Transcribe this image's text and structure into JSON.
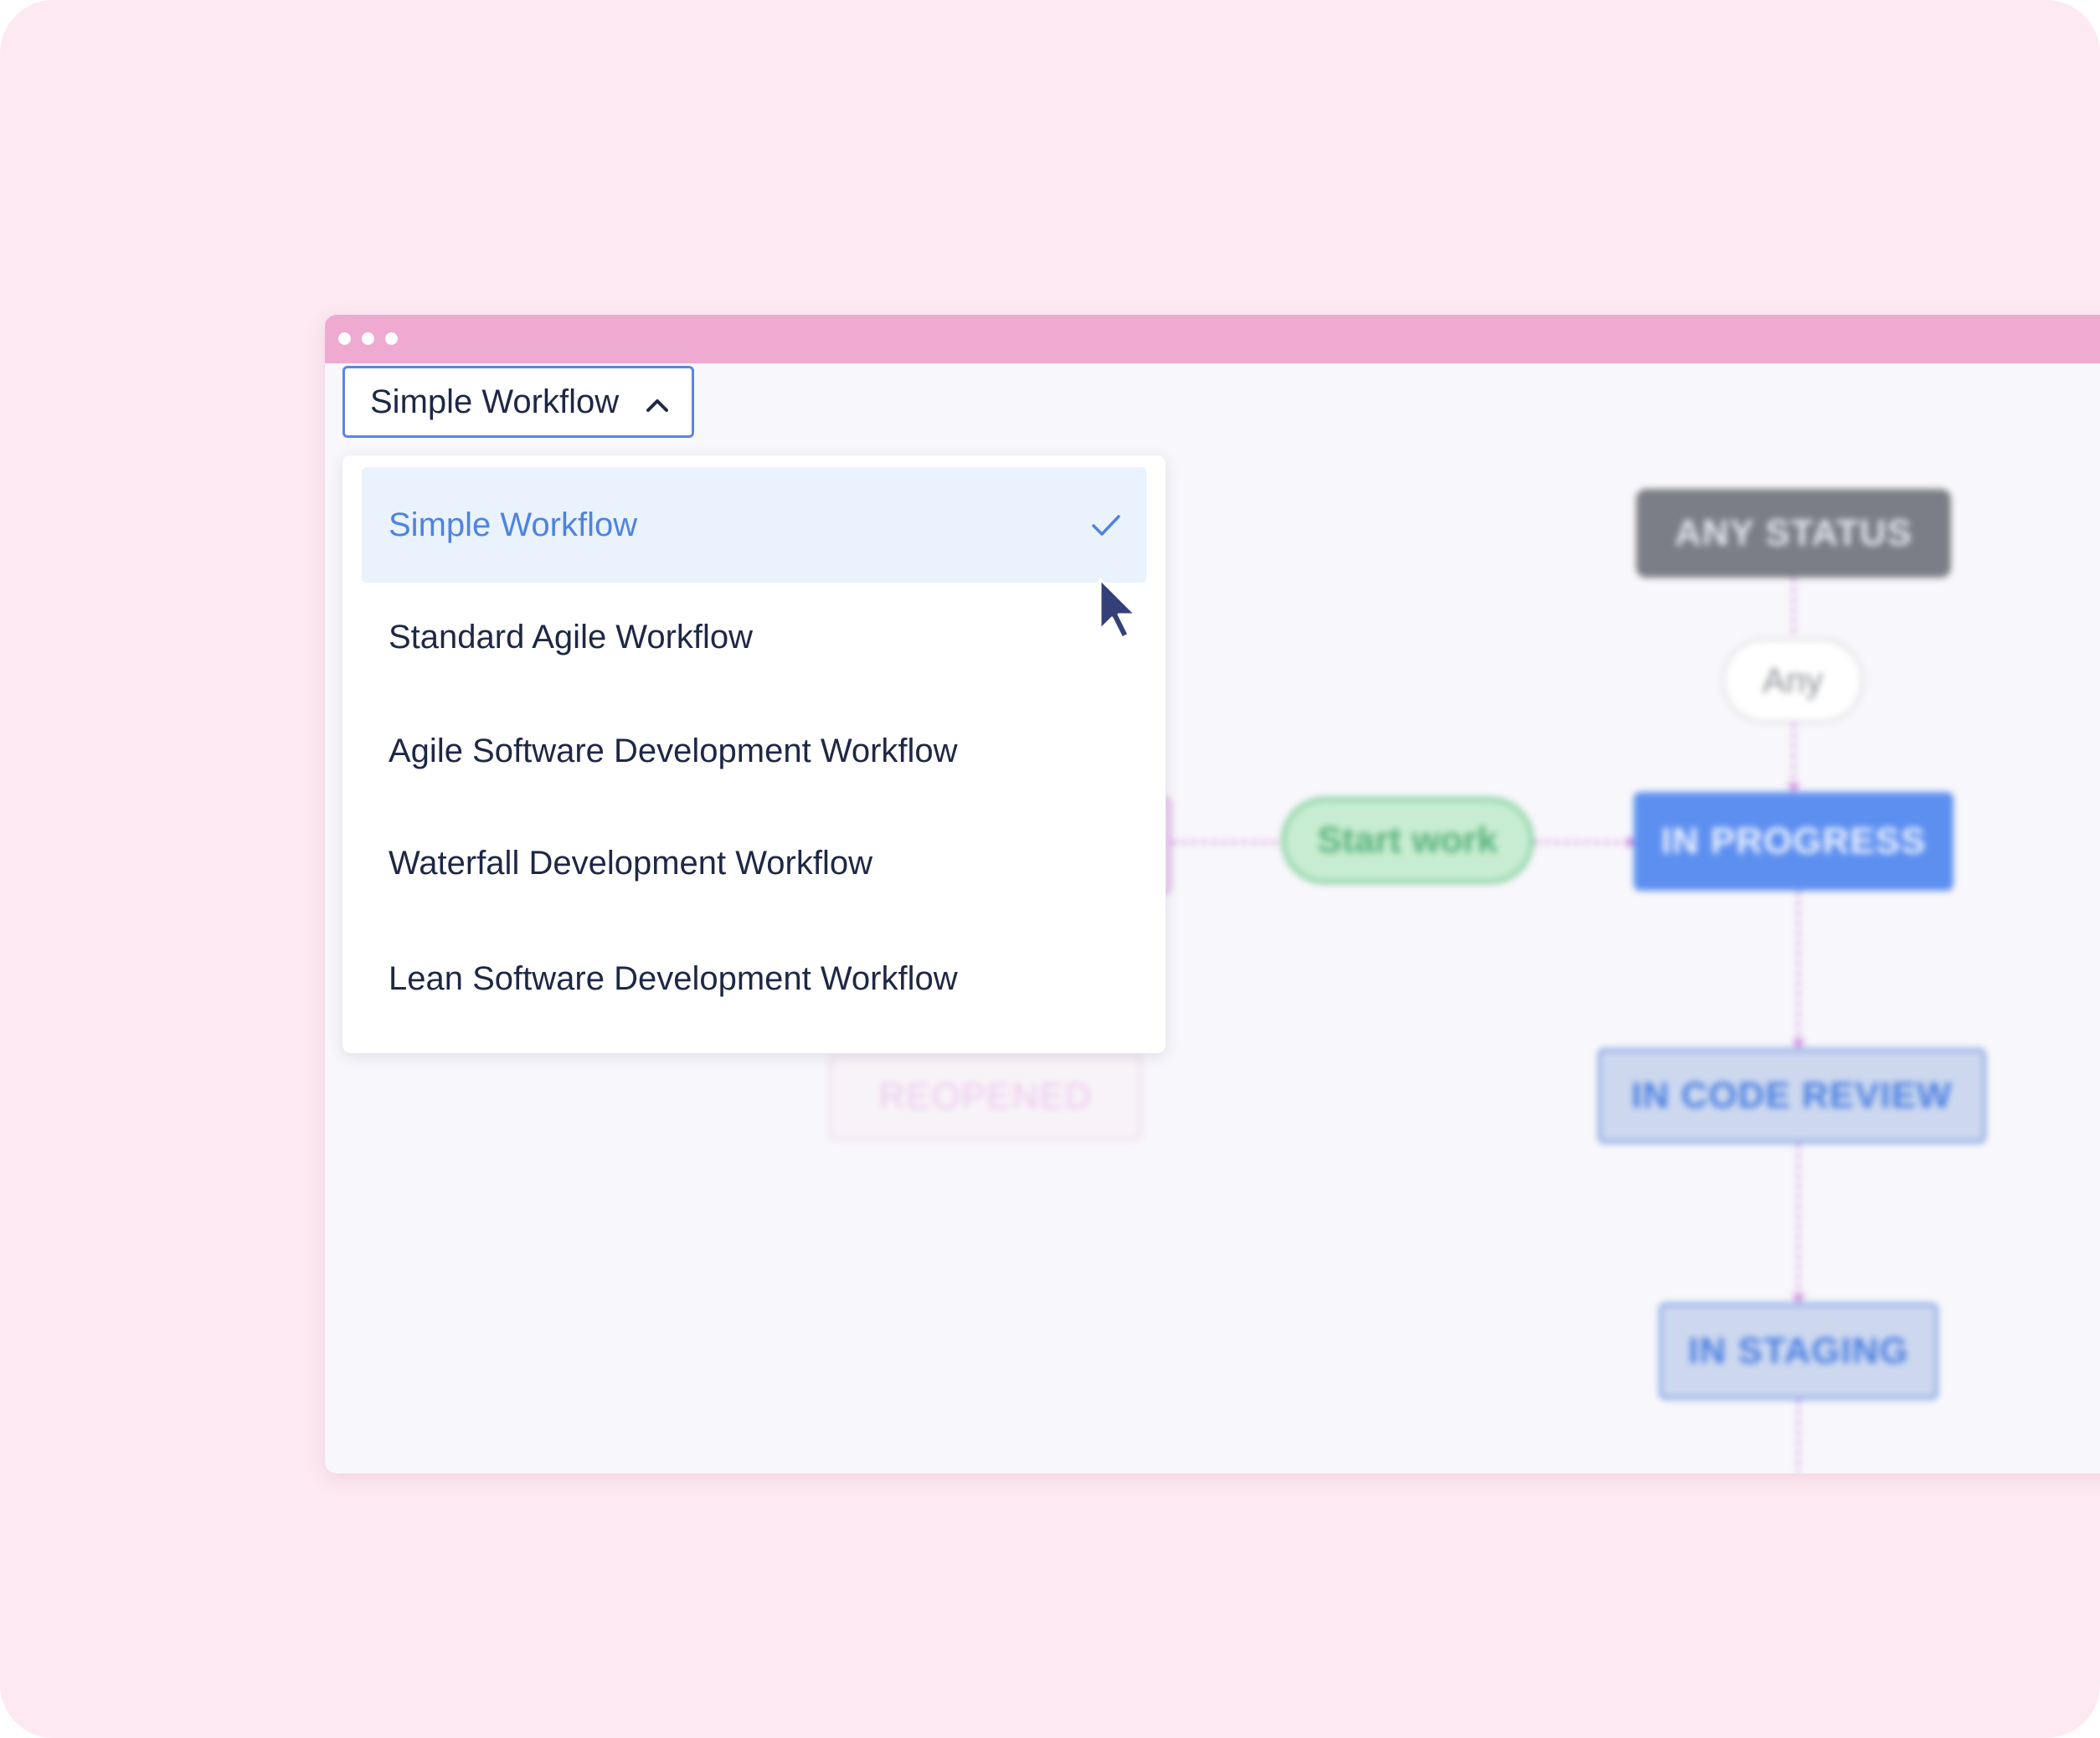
{
  "window": {
    "titlebar_color": "#eeaad0",
    "window_controls": [
      "dot",
      "dot",
      "dot"
    ]
  },
  "workflow_select": {
    "selected_value": "Simple Workflow",
    "expanded": true,
    "chevron_icon": "chevron-up-icon"
  },
  "dropdown": {
    "options": [
      {
        "label": "Simple Workflow",
        "selected": true
      },
      {
        "label": "Standard Agile Workflow",
        "selected": false
      },
      {
        "label": "Agile Software Development Workflow",
        "selected": false
      },
      {
        "label": "Waterfall Development Workflow",
        "selected": false
      },
      {
        "label": "Lean Software Development Workflow",
        "selected": false
      }
    ],
    "selected_check_icon": "check-icon",
    "accent_color": "#4f83de"
  },
  "diagram": {
    "nodes": {
      "any_status": "ANY STATUS",
      "any": "Any",
      "in_progress": "IN PROGRESS",
      "start_work": "Start work",
      "in_code_review": "IN CODE REVIEW",
      "in_staging": "IN STAGING",
      "reopened": "REOPENED"
    },
    "connector_color": "#c87ad8"
  },
  "cursor_icon": "mouse-pointer-icon"
}
